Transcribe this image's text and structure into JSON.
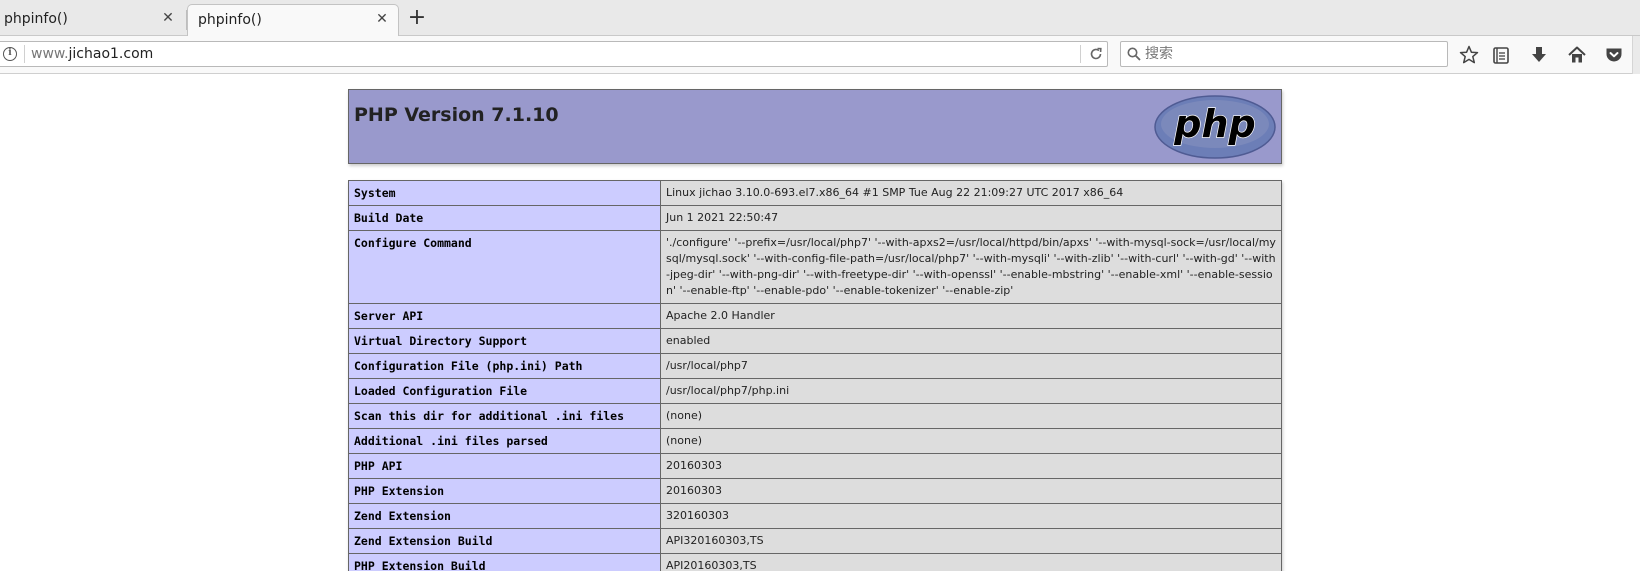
{
  "browser": {
    "tabs": [
      {
        "title": "phpinfo()",
        "active": false
      },
      {
        "title": "phpinfo()",
        "active": true
      }
    ],
    "url": {
      "prefix": "www.",
      "host": "jichao1.com"
    },
    "search": {
      "placeholder": "搜索"
    }
  },
  "page": {
    "title": "PHP Version 7.1.10",
    "logo_text": "php",
    "rows": [
      {
        "key": "System",
        "value": "Linux jichao 3.10.0-693.el7.x86_64 #1 SMP Tue Aug 22 21:09:27 UTC 2017 x86_64"
      },
      {
        "key": "Build Date",
        "value": "Jun 1 2021 22:50:47"
      },
      {
        "key": "Configure Command",
        "value": "'./configure' '--prefix=/usr/local/php7' '--with-apxs2=/usr/local/httpd/bin/apxs' '--with-mysql-sock=/usr/local/mysql/mysql.sock' '--with-config-file-path=/usr/local/php7' '--with-mysqli' '--with-zlib' '--with-curl' '--with-gd' '--with-jpeg-dir' '--with-png-dir' '--with-freetype-dir' '--with-openssl' '--enable-mbstring' '--enable-xml' '--enable-session' '--enable-ftp' '--enable-pdo' '--enable-tokenizer' '--enable-zip'"
      },
      {
        "key": "Server API",
        "value": "Apache 2.0 Handler"
      },
      {
        "key": "Virtual Directory Support",
        "value": "enabled"
      },
      {
        "key": "Configuration File (php.ini) Path",
        "value": "/usr/local/php7"
      },
      {
        "key": "Loaded Configuration File",
        "value": "/usr/local/php7/php.ini"
      },
      {
        "key": "Scan this dir for additional .ini files",
        "value": "(none)"
      },
      {
        "key": "Additional .ini files parsed",
        "value": "(none)"
      },
      {
        "key": "PHP API",
        "value": "20160303"
      },
      {
        "key": "PHP Extension",
        "value": "20160303"
      },
      {
        "key": "Zend Extension",
        "value": "320160303"
      },
      {
        "key": "Zend Extension Build",
        "value": "API320160303,TS"
      },
      {
        "key": "PHP Extension Build",
        "value": "API20160303,TS"
      }
    ]
  },
  "colors": {
    "header_bg": "#9999cc",
    "key_bg": "#ccccff",
    "value_bg": "#dddddd"
  }
}
